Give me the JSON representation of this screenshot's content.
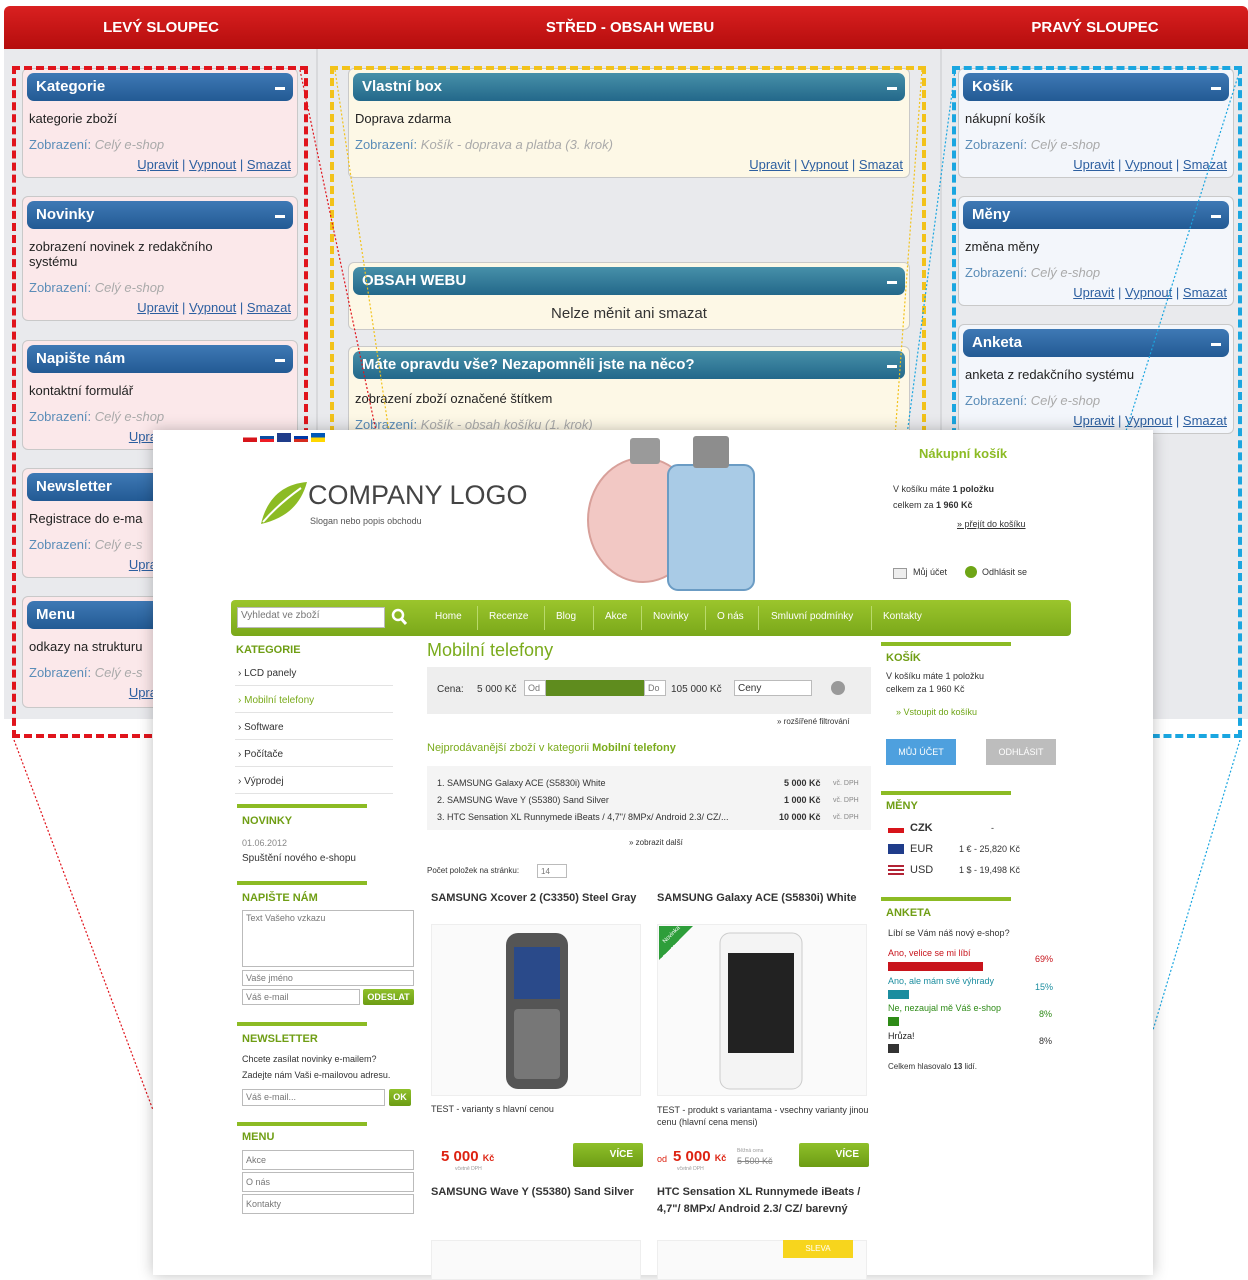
{
  "columns": {
    "left": "LEVÝ SLOUPEC",
    "center": "STŘED - OBSAH WEBU",
    "right": "PRAVÝ SLOUPEC"
  },
  "common": {
    "show_label": "Zobrazení:",
    "edit": "Upravit",
    "disable": "Vypnout",
    "delete": "Smazat",
    "sep": "|"
  },
  "left_boxes": [
    {
      "title": "Kategorie",
      "desc": "kategorie zboží",
      "scope": "Celý e-shop"
    },
    {
      "title": "Novinky",
      "desc": "zobrazení novinek z redakčního systému",
      "scope": "Celý e-shop"
    },
    {
      "title": "Napište nám",
      "desc": "kontaktní formulář",
      "scope": "Celý e-shop"
    },
    {
      "title": "Newsletter",
      "desc": "Registrace do e-ma",
      "scope": "Celý e-s"
    },
    {
      "title": "Menu",
      "desc": "odkazy na strukturu",
      "scope": "Celý e-s"
    }
  ],
  "left_partial_link": "Upra",
  "center_boxes": [
    {
      "title": "Vlastní box",
      "desc": "Doprava zdarma",
      "scope": "Košík - doprava a platba (3. krok)"
    },
    {
      "title": "OBSAH WEBU",
      "desc": "Nelze měnit ani smazat"
    },
    {
      "title": "Máte opravdu vše? Nezapomněli jste na něco?",
      "desc": "zobrazení zboží označené štítkem",
      "scope": "Košík - obsah košíku (1. krok)"
    }
  ],
  "right_boxes": [
    {
      "title": "Košík",
      "desc": "nákupní košík",
      "scope": "Celý e-shop"
    },
    {
      "title": "Měny",
      "desc": "změna měny",
      "scope": "Celý e-shop"
    },
    {
      "title": "Anketa",
      "desc": "anketa z redakčního systému",
      "scope": "Celý e-shop"
    }
  ],
  "shop": {
    "logo": "COMPANY LOGO",
    "slogan": "Slogan nebo popis obchodu",
    "cart_head": "Nákupní košík",
    "cart_line1": "V košíku máte",
    "cart_count": "1 položku",
    "cart_line2": "celkem za",
    "cart_total": "1 960 Kč",
    "cart_link": "» přejít do košíku",
    "account": "Můj účet",
    "logout": "Odhlásit se",
    "search_placeholder": "Vyhledat ve zboží",
    "nav": [
      "Home",
      "Recenze",
      "Blog",
      "Akce",
      "Novinky",
      "O nás",
      "Smluvní podmínky",
      "Kontakty"
    ],
    "cat_head": "KATEGORIE",
    "categories": [
      "› LCD panely",
      "› Mobilní telefony",
      "› Software",
      "› Počítače",
      "› Výprodej"
    ],
    "news_head": "NOVINKY",
    "news_date": "01.06.2012",
    "news_title": "Spuštění nového e-shopu",
    "contact_head": "NAPIŠTE NÁM",
    "contact_msg": "Text Vašeho vzkazu",
    "contact_name": "Vaše jméno",
    "contact_email": "Váš e-mail",
    "send": "ODESLAT",
    "nl_head": "NEWSLETTER",
    "nl_text1": "Chcete zasílat novinky e-mailem?",
    "nl_text2": "Zadejte nám Vaši e-mailovou adresu.",
    "nl_input": "Váš e-mail...",
    "nl_ok": "OK",
    "menu_head": "MENU",
    "menu": [
      "Akce",
      "O nás",
      "Kontakty"
    ],
    "page_title": "Mobilní telefony",
    "filter_label": "Cena:",
    "filter_min": "5 000 Kč",
    "filter_from": "Od",
    "filter_to": "Do",
    "filter_max": "105 000 Kč",
    "filter_select": "Ceny",
    "filter_adv": "» rozšířené filtrování",
    "best_label": "Nejprodávanější zboží v kategorii",
    "best_cat": "Mobilní telefony",
    "best": [
      {
        "name": "1. SAMSUNG Galaxy ACE (S5830i) White",
        "price": "5 000 Kč",
        "vat": "vč. DPH"
      },
      {
        "name": "2. SAMSUNG Wave Y (S5380) Sand Silver",
        "price": "1 000 Kč",
        "vat": "vč. DPH"
      },
      {
        "name": "3. HTC Sensation XL Runnymede iBeats / 4,7\"/ 8MPx/ Android 2.3/ CZ/...",
        "price": "10 000 Kč",
        "vat": "vč. DPH"
      }
    ],
    "more": "» zobrazit další",
    "per_page_label": "Počet položek na stránku:",
    "per_page": "14",
    "products": [
      {
        "title": "SAMSUNG Xcover 2 (C3350) Steel Gray",
        "desc": "TEST - varianty s hlavní cenou",
        "price": "5 000",
        "cur": "Kč",
        "vat": "včetně DPH",
        "btn": "VÍCE"
      },
      {
        "title": "SAMSUNG Galaxy ACE (S5830i) White",
        "badge": "Novinka",
        "desc": "TEST - produkt s variantama - vsechny varianty jinou cenu (hlavní cena mensi)",
        "from": "od",
        "price": "5 000",
        "cur": "Kč",
        "vat": "včetně DPH",
        "old_label": "Běžná cena",
        "old": "5 500 Kč",
        "btn": "VÍCE"
      },
      {
        "title": "SAMSUNG Wave Y (S5380) Sand Silver"
      },
      {
        "title": "HTC Sensation XL Runnymede iBeats / 4,7\"/ 8MPx/ Android 2.3/ CZ/ barevný",
        "badge": "SLEVA"
      }
    ],
    "rcart_head": "KOŠÍK",
    "rcart_line": "V košíku máte 1 položku",
    "rcart_total": "celkem za 1 960 Kč",
    "rcart_link": "» Vstoupit do košíku",
    "my_account_btn": "MŮJ ÚČET",
    "logout_btn": "ODHLÁSIT",
    "cur_head": "MĚNY",
    "currencies": [
      {
        "code": "CZK",
        "rate": "-"
      },
      {
        "code": "EUR",
        "rate": "1 € - 25,820 Kč"
      },
      {
        "code": "USD",
        "rate": "1 $ - 19,498 Kč"
      }
    ],
    "poll_head": "ANKETA",
    "poll_q": "Líbí se Vám náš nový e-shop?",
    "poll": [
      {
        "label": "Ano, velice se mi líbí",
        "pct": "69%",
        "value": 69,
        "color": "#c8141c"
      },
      {
        "label": "Ano, ale mám své výhrady",
        "pct": "15%",
        "value": 15,
        "color": "#1b8d9f"
      },
      {
        "label": "Ne, nezaujal mě Váš e-shop",
        "pct": "8%",
        "value": 8,
        "color": "#2e8b17"
      },
      {
        "label": "Hrůza!",
        "pct": "8%",
        "value": 8,
        "color": "#333333"
      }
    ],
    "poll_total": "Celkem hlasovalo",
    "poll_count": "13",
    "poll_people": "lidí."
  },
  "colors": {
    "red": "#c8141c",
    "blue": "#2f6ca8",
    "teal": "#23688a",
    "green": "#7aab1c",
    "yellow": "#f2c21a",
    "cyan": "#1aa6e0"
  }
}
